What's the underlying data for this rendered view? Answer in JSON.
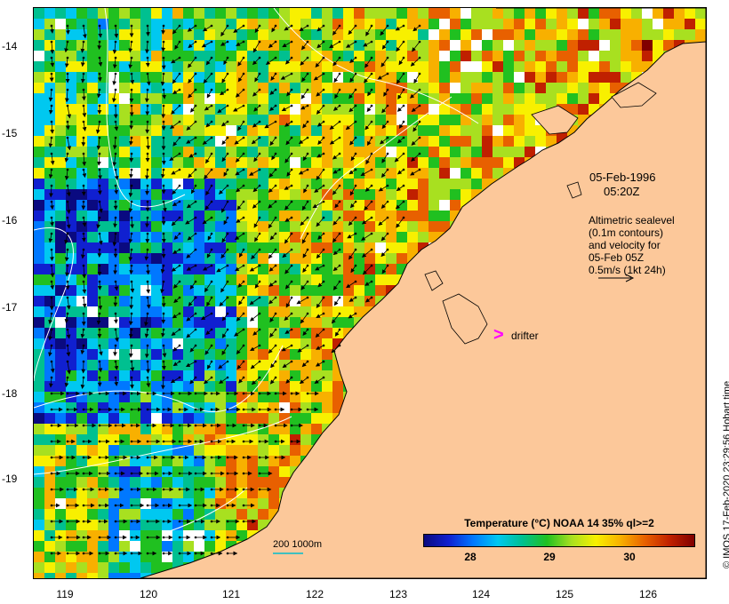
{
  "map": {
    "date": "05-Feb-1996",
    "time": "05:20Z",
    "legend_lines": [
      "Altimetric sealevel",
      "(0.1m contours)",
      "and velocity for",
      "05-Feb 05Z",
      "0.5m/s (1kt 24h)"
    ],
    "drifter_label": "drifter",
    "drifter_color": "#ff00ff",
    "land_color": "#fcc89a",
    "scale_label": "200  1000m",
    "y_ticks": [
      "-14",
      "-15",
      "-16",
      "-17",
      "-18",
      "-19"
    ],
    "x_ticks": [
      "119",
      "120",
      "121",
      "122",
      "123",
      "124",
      "125",
      "126"
    ],
    "colorbar": {
      "title": "Temperature (°C) NOAA 14 35% ql>=2",
      "ticks": [
        "28",
        "29",
        "30"
      ],
      "min": 27.4,
      "max": 30.8
    },
    "credit": "© IMOS 17-Feb-2020 23:29:56 Hobart time"
  }
}
